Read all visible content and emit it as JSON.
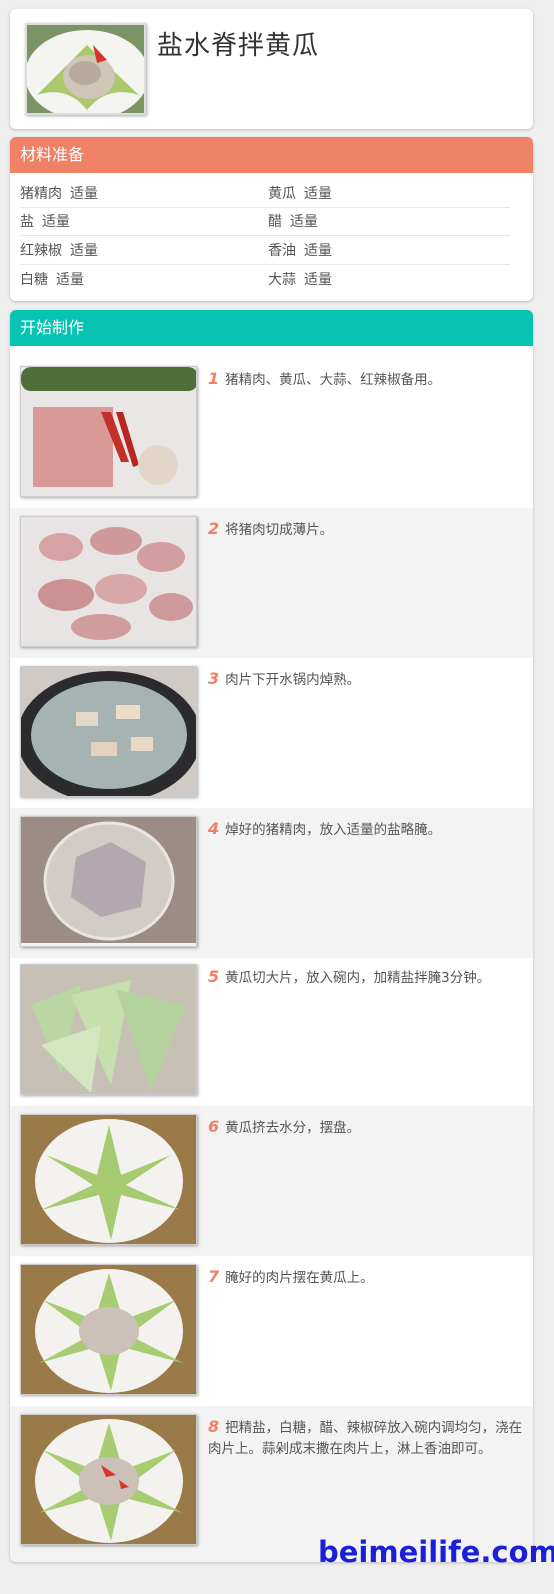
{
  "recipe": {
    "title": "盐水脊拌黄瓜"
  },
  "ingredients": {
    "header": "材料准备",
    "items": [
      {
        "name": "猪精肉",
        "amount": "适量"
      },
      {
        "name": "黄瓜",
        "amount": "适量"
      },
      {
        "name": "盐",
        "amount": "适量"
      },
      {
        "name": "醋",
        "amount": "适量"
      },
      {
        "name": "红辣椒",
        "amount": "适量"
      },
      {
        "name": "香油",
        "amount": "适量"
      },
      {
        "name": "白糖",
        "amount": "适量"
      },
      {
        "name": "大蒜",
        "amount": "适量"
      }
    ]
  },
  "steps": {
    "header": "开始制作",
    "items": [
      {
        "num": "1",
        "text": "猪精肉、黄瓜、大蒜、红辣椒备用。"
      },
      {
        "num": "2",
        "text": "将猪肉切成薄片。"
      },
      {
        "num": "3",
        "text": "肉片下开水锅内焯熟。"
      },
      {
        "num": "4",
        "text": "焯好的猪精肉，放入适量的盐略腌。"
      },
      {
        "num": "5",
        "text": "黄瓜切大片，放入碗内，加精盐拌腌3分钟。"
      },
      {
        "num": "6",
        "text": "黄瓜挤去水分，摆盘。"
      },
      {
        "num": "7",
        "text": "腌好的肉片摆在黄瓜上。"
      },
      {
        "num": "8",
        "text": "把精盐，白糖，醋、辣椒碎放入碗内调均匀，浇在肉片上。蒜剁成末撒在肉片上，淋上香油即可。"
      }
    ]
  },
  "watermark": "beimeilife.com",
  "colors": {
    "ingredients_header": "#ef8166",
    "steps_header": "#08c3b2",
    "step_number": "#ef8166",
    "watermark": "#1b20d8"
  }
}
